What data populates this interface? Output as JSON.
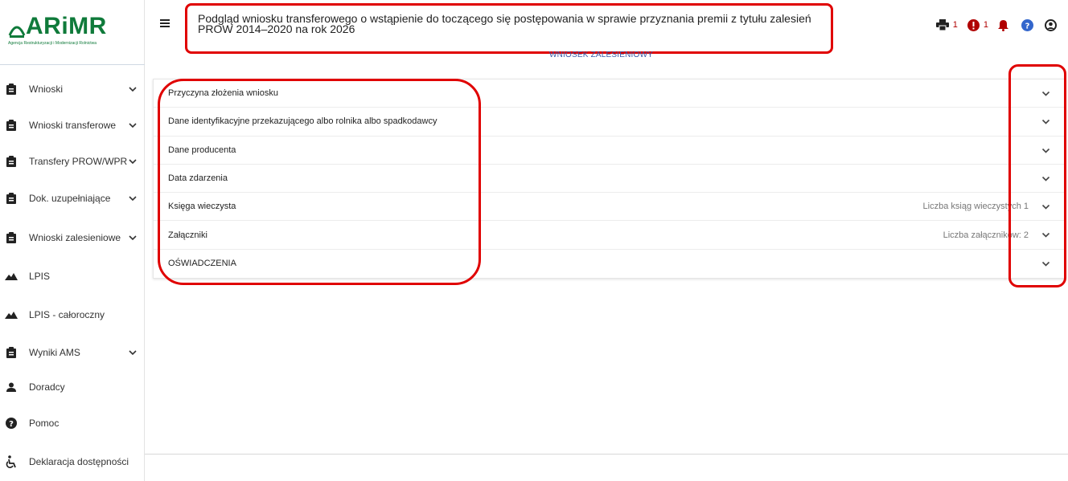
{
  "logo": {
    "text": "ARiMR",
    "subtitle": "Agencja Restrukturyzacji i Modernizacji Rolnictwa"
  },
  "sidebar": {
    "items": [
      {
        "label": "Wnioski",
        "icon": "clipboard-icon",
        "expandable": true
      },
      {
        "label": "Wnioski transferowe",
        "icon": "clipboard-icon",
        "expandable": true
      },
      {
        "label": "Transfery PROW/WPR",
        "icon": "clipboard-icon",
        "expandable": true
      },
      {
        "label": "Dok. uzupełniające",
        "icon": "clipboard-icon",
        "expandable": true
      },
      {
        "label": "Wnioski zalesieniowe",
        "icon": "clipboard-icon",
        "expandable": true
      },
      {
        "label": "LPIS",
        "icon": "mountain-icon",
        "expandable": false
      },
      {
        "label": "LPIS - całoroczny",
        "icon": "mountain-icon",
        "expandable": false
      },
      {
        "label": "Wyniki AMS",
        "icon": "clipboard-icon",
        "expandable": true
      },
      {
        "label": "Doradcy",
        "icon": "user-icon",
        "expandable": false
      },
      {
        "label": "Pomoc",
        "icon": "question-circle-icon",
        "expandable": false
      },
      {
        "label": "Deklaracja dostępności",
        "icon": "wheelchair-icon",
        "expandable": false
      }
    ]
  },
  "header": {
    "title": "Podgląd wniosku transferowego o wstąpienie do toczącego się postępowania w sprawie przyznania premii z tytułu zalesień PROW 2014–2020 na rok 2026",
    "subheading": "WNIOSEK ZALESIENIOWY",
    "error_count": "1",
    "notification_count": "1"
  },
  "accordion": {
    "rows": [
      {
        "label": "Przyczyna złożenia wniosku",
        "meta": ""
      },
      {
        "label": "Dane identyfikacyjne przekazującego albo rolnika albo spadkodawcy",
        "meta": ""
      },
      {
        "label": "Dane producenta",
        "meta": ""
      },
      {
        "label": "Data zdarzenia",
        "meta": ""
      },
      {
        "label": "Księga wieczysta",
        "meta": "Liczba ksiąg wieczystych 1"
      },
      {
        "label": "Załączniki",
        "meta": "Liczba załączników: 2"
      },
      {
        "label": "OŚWIADCZENIA",
        "meta": ""
      }
    ]
  },
  "colors": {
    "brand": "#0f7a3a",
    "accent": "#3a5aa8",
    "alert": "#b00000",
    "annotation": "#e00000"
  }
}
